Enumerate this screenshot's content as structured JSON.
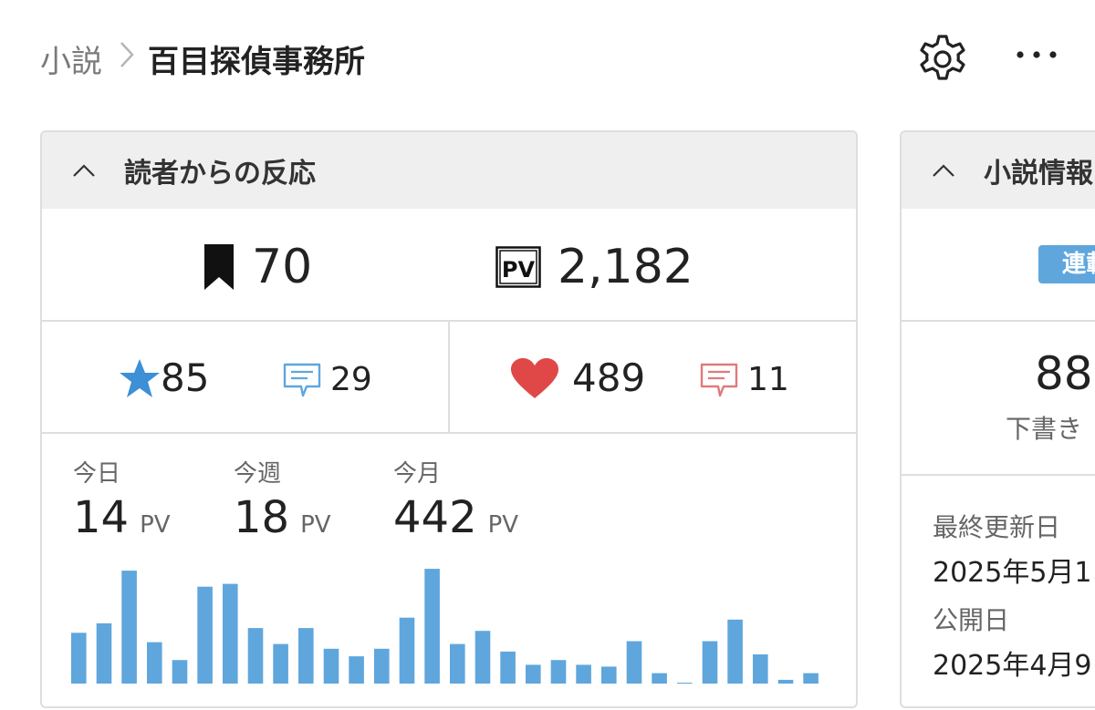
{
  "breadcrumb": {
    "parent": "小説",
    "current": "百目探偵事務所"
  },
  "header_icons": [
    "gear-icon",
    "more-icon"
  ],
  "reaction_panel": {
    "title": "読者からの反応",
    "bookmarks": "70",
    "pv_total": "2,182",
    "stars": "85",
    "star_reviews": "29",
    "hearts": "489",
    "heart_comments": "11",
    "periods": [
      {
        "label": "今日",
        "value": "14",
        "unit": "PV"
      },
      {
        "label": "今週",
        "value": "18",
        "unit": "PV"
      },
      {
        "label": "今月",
        "value": "442",
        "unit": "PV"
      }
    ],
    "colors": {
      "accent_blue": "#5fa6dd",
      "heart_red": "#e04848",
      "comment_red": "#e07a7a"
    }
  },
  "chart_data": {
    "type": "bar",
    "values": [
      54,
      64,
      120,
      44,
      25,
      103,
      106,
      59,
      42,
      59,
      37,
      29,
      37,
      70,
      122,
      42,
      56,
      34,
      20,
      25,
      20,
      18,
      45,
      11,
      1,
      45,
      68,
      31,
      4,
      11
    ]
  },
  "info_panel": {
    "title": "小説情報",
    "status_badge": "連載中",
    "count": "88",
    "count_label": "下書き",
    "updated_label": "最終更新日",
    "updated_value": "2025年5月1",
    "published_label": "公開日",
    "published_value": "2025年4月9"
  }
}
